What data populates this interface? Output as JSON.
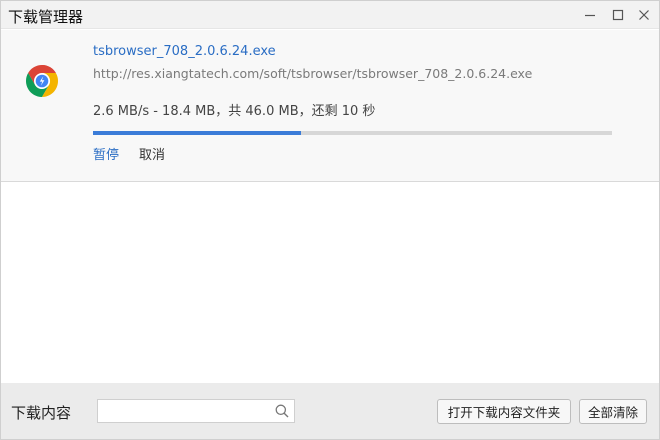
{
  "window": {
    "title": "下载管理器",
    "controls": [
      "minimize-icon",
      "maximize-icon",
      "close-icon"
    ]
  },
  "download": {
    "icon": "chrome-logo-icon",
    "file_name": "tsbrowser_708_2.0.6.24.exe",
    "url": "http://res.xiangtatech.com/soft/tsbrowser/tsbrowser_708_2.0.6.24.exe",
    "status": "2.6 MB/s - 18.4 MB，共 46.0 MB，还剩 10 秒",
    "progress_fraction": 0.4,
    "actions": {
      "pause": "暂停",
      "cancel": "取消"
    }
  },
  "footer": {
    "label": "下载内容",
    "search": {
      "value": "",
      "placeholder": "",
      "icon": "search-icon"
    },
    "open_folder_button": "打开下载内容文件夹",
    "clear_all_button": "全部清除"
  },
  "colors": {
    "link": "#2a6dc4",
    "progress": "#3b7cd8",
    "track": "#d7d7d7"
  }
}
